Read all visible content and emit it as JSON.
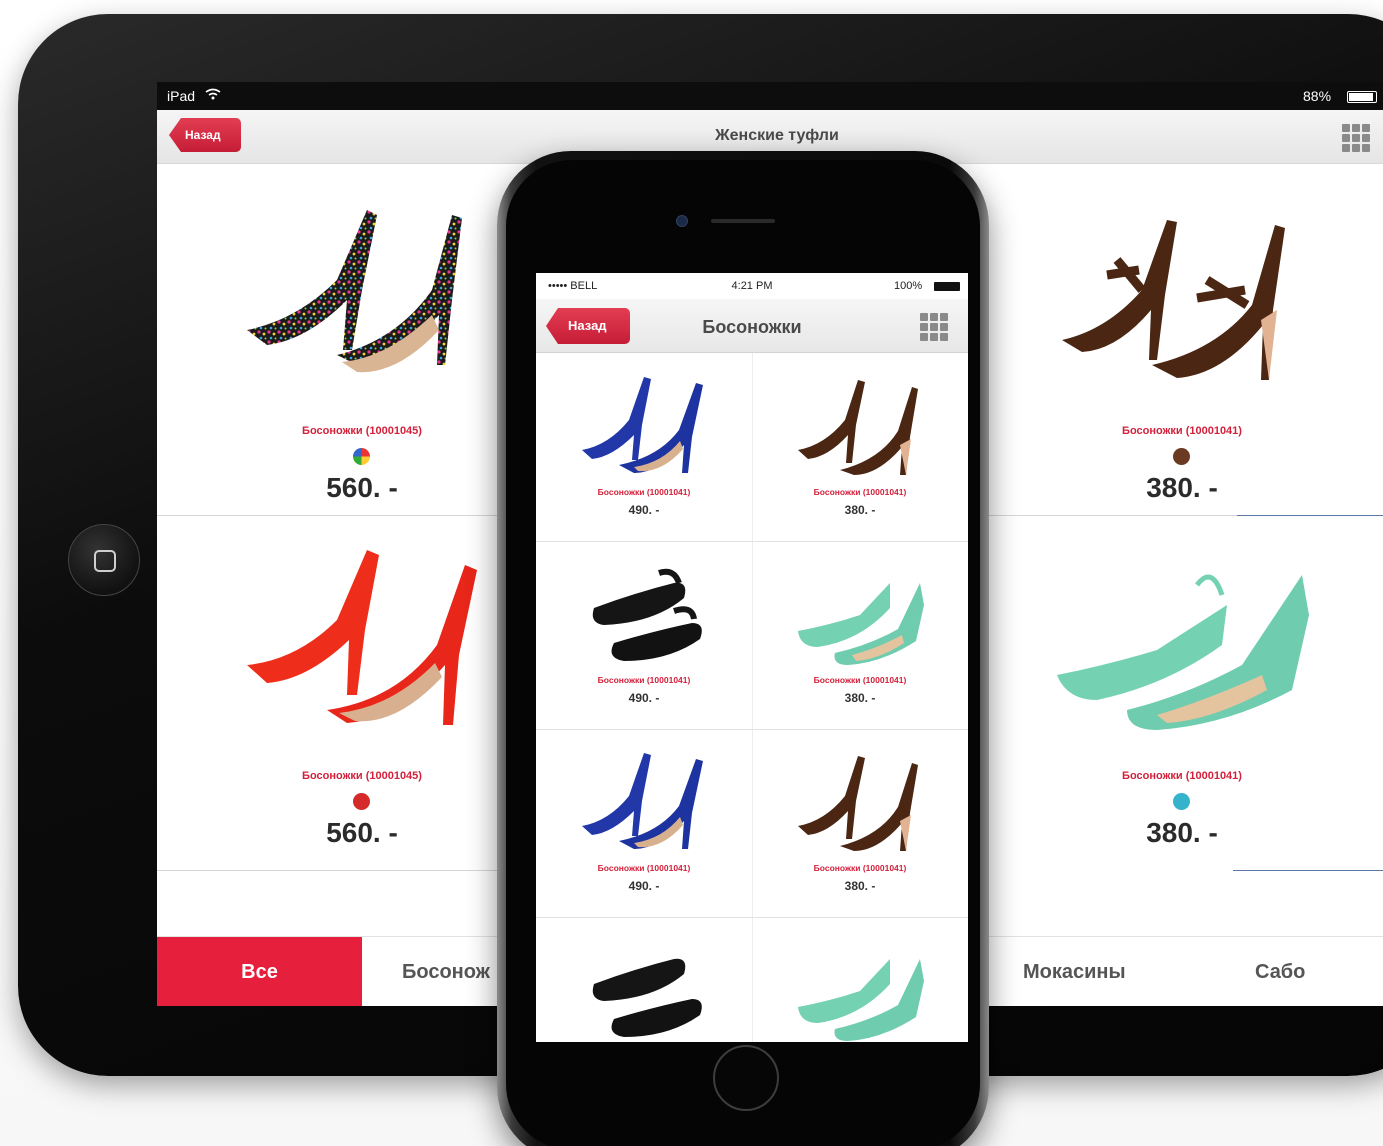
{
  "ipad": {
    "status": {
      "device": "iPad",
      "battery": "88%"
    },
    "nav": {
      "back_label": "Назад",
      "title": "Женские туфли"
    },
    "products": [
      {
        "name": "Босоножки (10001045)",
        "price": "560. -",
        "color": "multicolor"
      },
      {
        "name": "Босоножки (10001041)",
        "price": "380. -",
        "color": "#6b3a22"
      },
      {
        "name": "Босоножки (10001045)",
        "price": "560. -",
        "color": "#d42a2a"
      },
      {
        "name": "Босоножки (10001041)",
        "price": "380. -",
        "color": "#35b3cc"
      }
    ],
    "tabs": [
      {
        "label": "Все",
        "active": true
      },
      {
        "label": "Босонож"
      },
      {
        "label": "Мокасины"
      },
      {
        "label": "Сабо"
      }
    ]
  },
  "iphone": {
    "status": {
      "carrier": "•••••  BELL",
      "time": "4:21 PM",
      "battery": "100%"
    },
    "nav": {
      "back_label": "Назад",
      "title": "Босоножки"
    },
    "products": [
      {
        "name": "Босоножки (10001041)",
        "price": "490. -",
        "color": "blue"
      },
      {
        "name": "Босоножки (10001041)",
        "price": "380. -",
        "color": "brown"
      },
      {
        "name": "Босоножки (10001041)",
        "price": "490. -",
        "color": "black"
      },
      {
        "name": "Босоножки (10001041)",
        "price": "380. -",
        "color": "mint"
      },
      {
        "name": "Босоножки (10001041)",
        "price": "490. -",
        "color": "blue"
      },
      {
        "name": "Босоножки (10001041)",
        "price": "380. -",
        "color": "brown"
      },
      {
        "name": "",
        "price": "",
        "color": "black"
      },
      {
        "name": "",
        "price": "",
        "color": "mint"
      }
    ]
  },
  "colors": {
    "accent": "#e51f3c",
    "price_text": "#2b2b2b"
  }
}
